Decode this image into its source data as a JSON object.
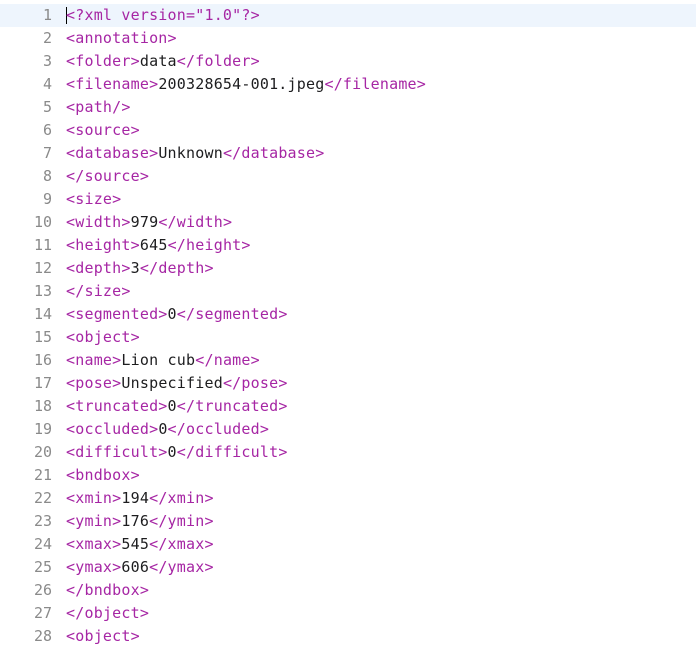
{
  "editor": {
    "activeLine": 1,
    "lines": [
      {
        "num": "1",
        "segments": [
          {
            "cls": "tag",
            "t": "<?xml version=\"1.0\"?>"
          }
        ]
      },
      {
        "num": "2",
        "segments": [
          {
            "cls": "tag",
            "t": "<annotation>"
          }
        ]
      },
      {
        "num": "3",
        "segments": [
          {
            "cls": "tag",
            "t": "<folder>"
          },
          {
            "cls": "txt",
            "t": "data"
          },
          {
            "cls": "tag",
            "t": "</folder>"
          }
        ]
      },
      {
        "num": "4",
        "segments": [
          {
            "cls": "tag",
            "t": "<filename>"
          },
          {
            "cls": "txt",
            "t": "200328654-001.jpeg"
          },
          {
            "cls": "tag",
            "t": "</filename>"
          }
        ]
      },
      {
        "num": "5",
        "segments": [
          {
            "cls": "tag",
            "t": "<path/>"
          }
        ]
      },
      {
        "num": "6",
        "segments": [
          {
            "cls": "tag",
            "t": "<source>"
          }
        ]
      },
      {
        "num": "7",
        "segments": [
          {
            "cls": "tag",
            "t": "<database>"
          },
          {
            "cls": "txt",
            "t": "Unknown"
          },
          {
            "cls": "tag",
            "t": "</database>"
          }
        ]
      },
      {
        "num": "8",
        "segments": [
          {
            "cls": "tag",
            "t": "</source>"
          }
        ]
      },
      {
        "num": "9",
        "segments": [
          {
            "cls": "tag",
            "t": "<size>"
          }
        ]
      },
      {
        "num": "10",
        "segments": [
          {
            "cls": "tag",
            "t": "<width>"
          },
          {
            "cls": "txt",
            "t": "979"
          },
          {
            "cls": "tag",
            "t": "</width>"
          }
        ]
      },
      {
        "num": "11",
        "segments": [
          {
            "cls": "tag",
            "t": "<height>"
          },
          {
            "cls": "txt",
            "t": "645"
          },
          {
            "cls": "tag",
            "t": "</height>"
          }
        ]
      },
      {
        "num": "12",
        "segments": [
          {
            "cls": "tag",
            "t": "<depth>"
          },
          {
            "cls": "txt",
            "t": "3"
          },
          {
            "cls": "tag",
            "t": "</depth>"
          }
        ]
      },
      {
        "num": "13",
        "segments": [
          {
            "cls": "tag",
            "t": "</size>"
          }
        ]
      },
      {
        "num": "14",
        "segments": [
          {
            "cls": "tag",
            "t": "<segmented>"
          },
          {
            "cls": "txt",
            "t": "0"
          },
          {
            "cls": "tag",
            "t": "</segmented>"
          }
        ]
      },
      {
        "num": "15",
        "segments": [
          {
            "cls": "tag",
            "t": "<object>"
          }
        ]
      },
      {
        "num": "16",
        "segments": [
          {
            "cls": "tag",
            "t": "<name>"
          },
          {
            "cls": "txt",
            "t": "Lion cub"
          },
          {
            "cls": "tag",
            "t": "</name>"
          }
        ]
      },
      {
        "num": "17",
        "segments": [
          {
            "cls": "tag",
            "t": "<pose>"
          },
          {
            "cls": "txt",
            "t": "Unspecified"
          },
          {
            "cls": "tag",
            "t": "</pose>"
          }
        ]
      },
      {
        "num": "18",
        "segments": [
          {
            "cls": "tag",
            "t": "<truncated>"
          },
          {
            "cls": "txt",
            "t": "0"
          },
          {
            "cls": "tag",
            "t": "</truncated>"
          }
        ]
      },
      {
        "num": "19",
        "segments": [
          {
            "cls": "tag",
            "t": "<occluded>"
          },
          {
            "cls": "txt",
            "t": "0"
          },
          {
            "cls": "tag",
            "t": "</occluded>"
          }
        ]
      },
      {
        "num": "20",
        "segments": [
          {
            "cls": "tag",
            "t": "<difficult>"
          },
          {
            "cls": "txt",
            "t": "0"
          },
          {
            "cls": "tag",
            "t": "</difficult>"
          }
        ]
      },
      {
        "num": "21",
        "segments": [
          {
            "cls": "tag",
            "t": "<bndbox>"
          }
        ]
      },
      {
        "num": "22",
        "segments": [
          {
            "cls": "tag",
            "t": "<xmin>"
          },
          {
            "cls": "txt",
            "t": "194"
          },
          {
            "cls": "tag",
            "t": "</xmin>"
          }
        ]
      },
      {
        "num": "23",
        "segments": [
          {
            "cls": "tag",
            "t": "<ymin>"
          },
          {
            "cls": "txt",
            "t": "176"
          },
          {
            "cls": "tag",
            "t": "</ymin>"
          }
        ]
      },
      {
        "num": "24",
        "segments": [
          {
            "cls": "tag",
            "t": "<xmax>"
          },
          {
            "cls": "txt",
            "t": "545"
          },
          {
            "cls": "tag",
            "t": "</xmax>"
          }
        ]
      },
      {
        "num": "25",
        "segments": [
          {
            "cls": "tag",
            "t": "<ymax>"
          },
          {
            "cls": "txt",
            "t": "606"
          },
          {
            "cls": "tag",
            "t": "</ymax>"
          }
        ]
      },
      {
        "num": "26",
        "segments": [
          {
            "cls": "tag",
            "t": "</bndbox>"
          }
        ]
      },
      {
        "num": "27",
        "segments": [
          {
            "cls": "tag",
            "t": "</object>"
          }
        ]
      },
      {
        "num": "28",
        "segments": [
          {
            "cls": "tag",
            "t": "<object>"
          }
        ]
      }
    ]
  }
}
